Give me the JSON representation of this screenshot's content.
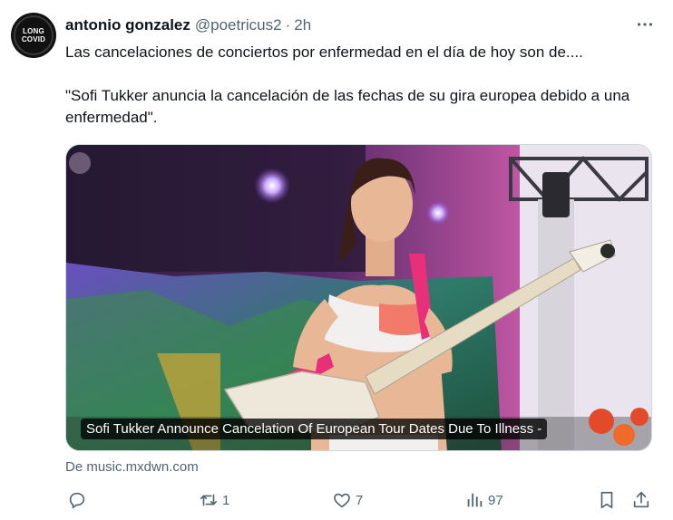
{
  "author": {
    "name": "antonio gonzalez",
    "handle": "@poetricus2",
    "separator": "·",
    "time": "2h",
    "avatar_text": [
      "LONG",
      "COVID"
    ]
  },
  "post": {
    "line1": "Las cancelaciones de conciertos por enfermedad en el día de hoy son de....",
    "line2": "\"Sofi Tukker anuncia la cancelación de las fechas de su gira europea debido a una enfermedad\"."
  },
  "card": {
    "caption": "Sofi Tukker Announce Cancelation Of European Tour Dates Due To Illness -",
    "source": "De music.mxdwn.com"
  },
  "actions": {
    "reply_count": "",
    "repost_count": "1",
    "like_count": "7",
    "views_count": "97"
  },
  "icons": {
    "more": "more-icon",
    "reply": "reply-icon",
    "repost": "repost-icon",
    "like": "heart-icon",
    "views": "views-icon",
    "bookmark": "bookmark-icon",
    "share": "share-icon"
  }
}
